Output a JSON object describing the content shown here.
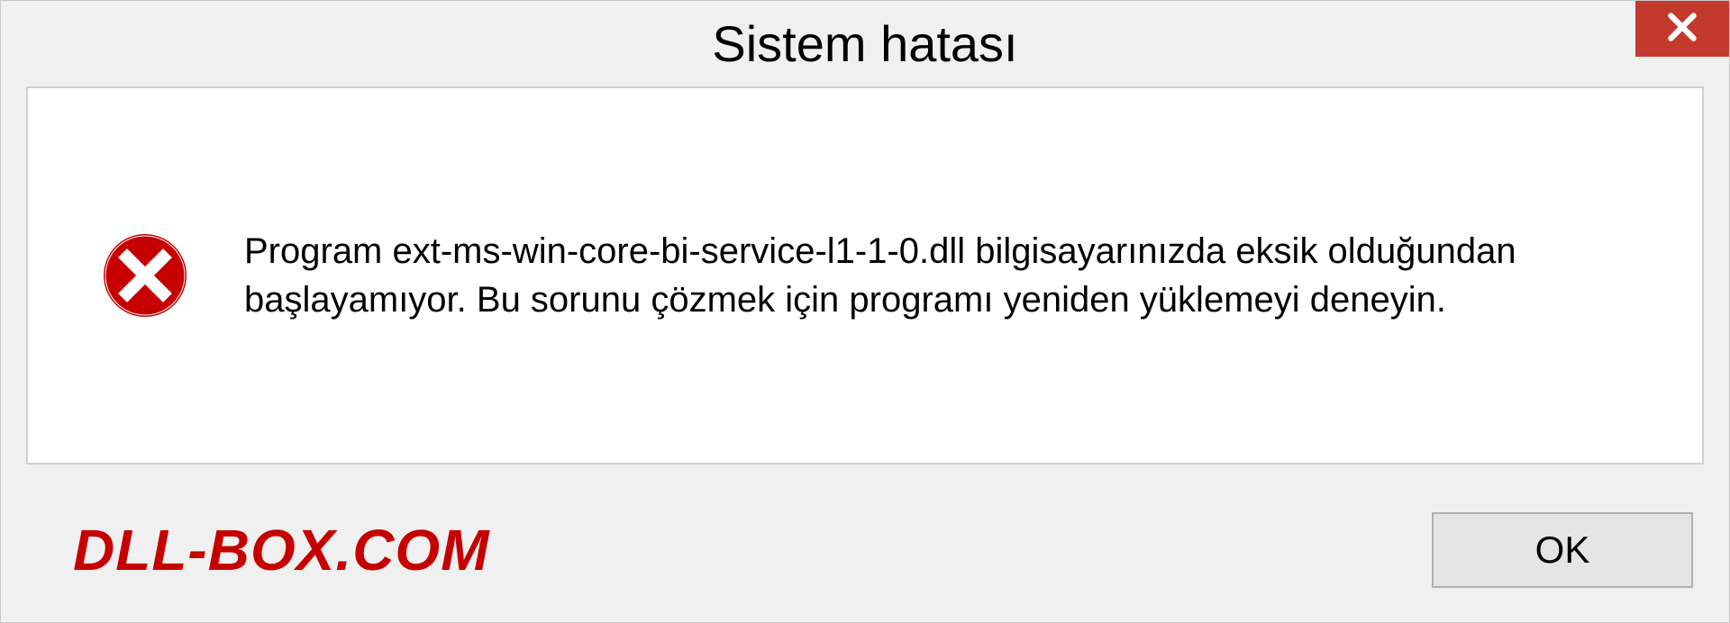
{
  "dialog": {
    "title": "Sistem hatası",
    "message": "Program ext-ms-win-core-bi-service-l1-1-0.dll bilgisayarınızda eksik olduğundan başlayamıyor. Bu sorunu çözmek için programı yeniden yüklemeyi deneyin.",
    "ok_label": "OK",
    "watermark": "DLL-BOX.COM"
  }
}
